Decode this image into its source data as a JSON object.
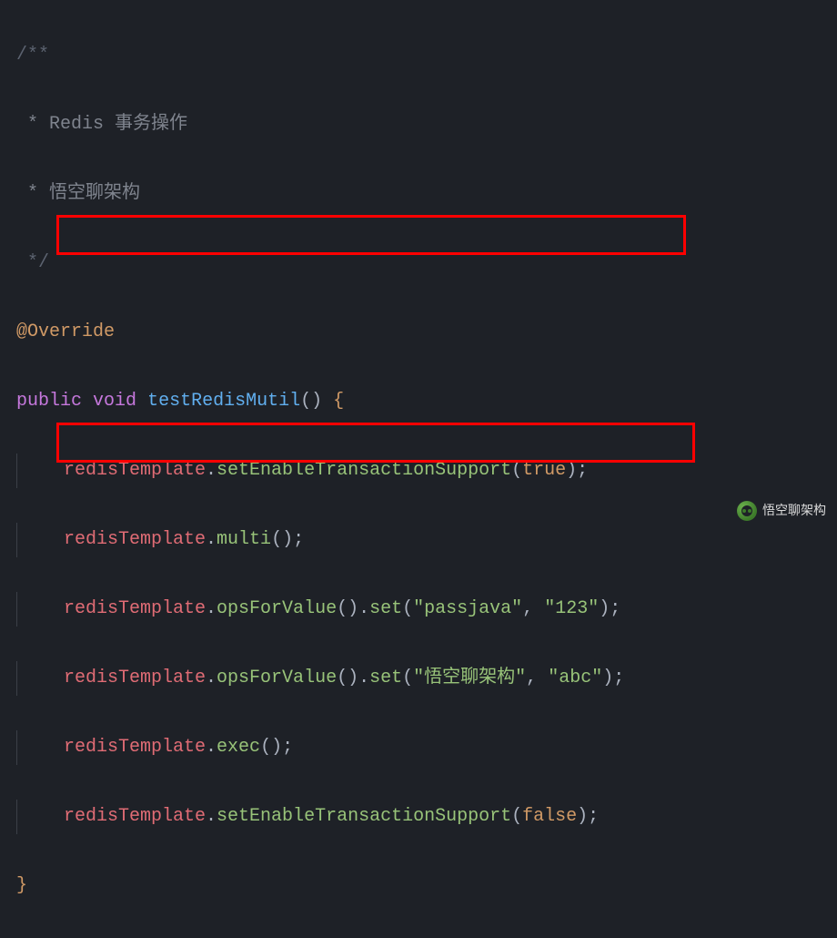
{
  "comment": {
    "open": "/**",
    "line1": " * Redis 事务操作",
    "line2": " * 悟空聊架构",
    "close": " */"
  },
  "annotation": "@Override",
  "decl": {
    "keyword_public": "public",
    "keyword_void": "void",
    "method_name": "testRedisMutil",
    "parens": "()",
    "brace_open": " {"
  },
  "var": "redisTemplate",
  "dot": ".",
  "semi": ";",
  "comma": ", ",
  "dq": "\"",
  "calls": {
    "setEnable": "setEnableTransactionSupport",
    "multi": "multi",
    "opsForValue": "opsForValue",
    "set": "set",
    "exec": "exec"
  },
  "bools": {
    "true": "true",
    "false": "false"
  },
  "strings": {
    "pj": "passjava",
    "v1": "123",
    "wk": "悟空聊架构",
    "v2": "abc"
  },
  "brace_close": "}",
  "watermark": "悟空聊架构"
}
